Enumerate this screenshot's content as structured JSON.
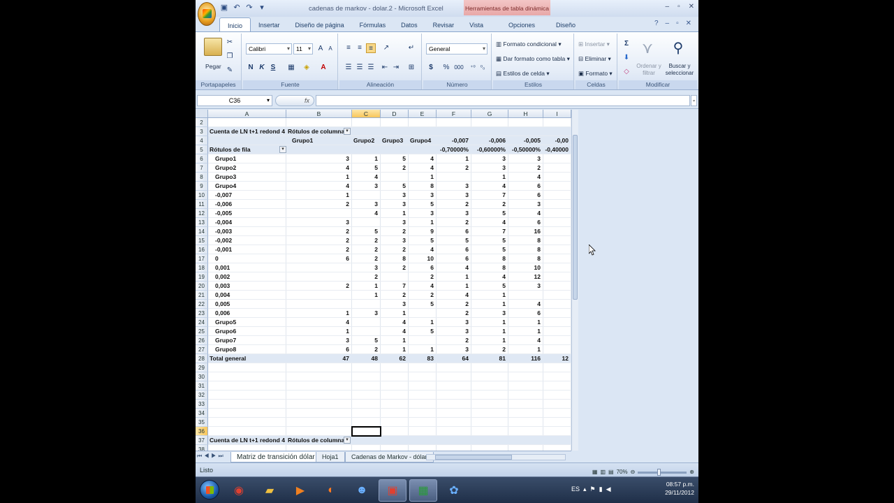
{
  "window": {
    "title": "cadenas de markov - dolar.2 - Microsoft Excel",
    "context_tab": "Herramientas de tabla dinámica"
  },
  "ribbon_tabs": [
    "Inicio",
    "Insertar",
    "Diseño de página",
    "Fórmulas",
    "Datos",
    "Revisar",
    "Vista",
    "Opciones",
    "Diseño"
  ],
  "ribbon": {
    "clipboard": {
      "paste": "Pegar",
      "label": "Portapapeles"
    },
    "font": {
      "name": "Calibri",
      "size": "11",
      "bold": "N",
      "italic": "K",
      "underline": "S",
      "label": "Fuente"
    },
    "align": {
      "label": "Alineación"
    },
    "number": {
      "format": "General",
      "currency": "$",
      "percent": "%",
      "thousands": "000",
      "label": "Número"
    },
    "styles": {
      "cond": "Formato condicional",
      "table": "Dar formato como tabla",
      "cell": "Estilos de celda",
      "label": "Estilos"
    },
    "cells": {
      "insert": "Insertar",
      "delete": "Eliminar",
      "format": "Formato",
      "label": "Celdas"
    },
    "edit": {
      "sort": "Ordenar y filtrar",
      "find": "Buscar y seleccionar",
      "label": "Modificar"
    }
  },
  "formula": {
    "namebox": "C36",
    "fx": "fx",
    "value": ""
  },
  "columns": [
    "A",
    "B",
    "C",
    "D",
    "E",
    "F",
    "G",
    "H",
    "I"
  ],
  "pivot": {
    "r3a": "Cuenta de LN t+1 redond 4",
    "r3b": "Rótulos de columna",
    "r4": [
      "Grupo1",
      "Grupo2",
      "Grupo3",
      "Grupo4",
      "-0,007",
      "-0,006",
      "-0,005",
      "-0,00"
    ],
    "r5a": "Rótulos de fila",
    "r5": [
      "-0,70000%",
      "-0,60000%",
      "-0,50000%",
      "-0,40000"
    ],
    "rows": [
      {
        "n": "6",
        "label": "Grupo1",
        "v": [
          "3",
          "1",
          "5",
          "4",
          "1",
          "3",
          "3"
        ]
      },
      {
        "n": "7",
        "label": "Grupo2",
        "v": [
          "4",
          "5",
          "2",
          "4",
          "2",
          "3",
          "2"
        ]
      },
      {
        "n": "8",
        "label": "Grupo3",
        "v": [
          "1",
          "4",
          "",
          "1",
          "",
          "1",
          "4"
        ]
      },
      {
        "n": "9",
        "label": "Grupo4",
        "v": [
          "4",
          "3",
          "5",
          "8",
          "3",
          "4",
          "6"
        ]
      },
      {
        "n": "10",
        "label": "-0,007",
        "v": [
          "1",
          "",
          "3",
          "3",
          "3",
          "7",
          "6"
        ]
      },
      {
        "n": "11",
        "label": "-0,006",
        "v": [
          "2",
          "3",
          "3",
          "5",
          "2",
          "2",
          "3"
        ]
      },
      {
        "n": "12",
        "label": "-0,005",
        "v": [
          "",
          "4",
          "1",
          "3",
          "3",
          "5",
          "4"
        ]
      },
      {
        "n": "13",
        "label": "-0,004",
        "v": [
          "3",
          "",
          "3",
          "1",
          "2",
          "4",
          "6"
        ]
      },
      {
        "n": "14",
        "label": "-0,003",
        "v": [
          "2",
          "5",
          "2",
          "9",
          "6",
          "7",
          "16"
        ]
      },
      {
        "n": "15",
        "label": "-0,002",
        "v": [
          "2",
          "2",
          "3",
          "5",
          "5",
          "5",
          "8"
        ]
      },
      {
        "n": "16",
        "label": "-0,001",
        "v": [
          "2",
          "2",
          "2",
          "4",
          "6",
          "5",
          "8"
        ]
      },
      {
        "n": "17",
        "label": "0",
        "v": [
          "6",
          "2",
          "8",
          "10",
          "6",
          "8",
          "8"
        ]
      },
      {
        "n": "18",
        "label": "0,001",
        "v": [
          "",
          "3",
          "2",
          "6",
          "4",
          "8",
          "10"
        ]
      },
      {
        "n": "19",
        "label": "0,002",
        "v": [
          "",
          "2",
          "",
          "2",
          "1",
          "4",
          "12"
        ]
      },
      {
        "n": "20",
        "label": "0,003",
        "v": [
          "2",
          "1",
          "7",
          "4",
          "1",
          "5",
          "3"
        ]
      },
      {
        "n": "21",
        "label": "0,004",
        "v": [
          "",
          "1",
          "2",
          "2",
          "4",
          "1",
          ""
        ]
      },
      {
        "n": "22",
        "label": "0,005",
        "v": [
          "",
          "",
          "3",
          "5",
          "2",
          "1",
          "4"
        ]
      },
      {
        "n": "23",
        "label": "0,006",
        "v": [
          "1",
          "3",
          "1",
          "",
          "2",
          "3",
          "6"
        ]
      },
      {
        "n": "24",
        "label": "Grupo5",
        "v": [
          "4",
          "",
          "4",
          "1",
          "3",
          "1",
          "1"
        ]
      },
      {
        "n": "25",
        "label": "Grupo6",
        "v": [
          "1",
          "",
          "4",
          "5",
          "3",
          "1",
          "1"
        ]
      },
      {
        "n": "26",
        "label": "Grupo7",
        "v": [
          "3",
          "5",
          "1",
          "",
          "2",
          "1",
          "4"
        ]
      },
      {
        "n": "27",
        "label": "Grupo8",
        "v": [
          "6",
          "2",
          "1",
          "1",
          "3",
          "2",
          "1"
        ]
      }
    ],
    "total": {
      "n": "28",
      "label": "Total general",
      "v": [
        "47",
        "48",
        "62",
        "83",
        "64",
        "81",
        "116",
        "12"
      ]
    },
    "empty_rows": [
      "29",
      "30",
      "31",
      "32",
      "33",
      "34",
      "35",
      "36"
    ],
    "r37a": "Cuenta de LN t+1 redond 4",
    "r37b": "Rótulos de columna"
  },
  "sheets": [
    "Matriz de transición dólar",
    "Hoja1",
    "Cadenas de Markov - dólar"
  ],
  "status": {
    "text": "Listo",
    "zoom": "70%"
  },
  "tray": {
    "lang": "ES",
    "time": "08:57 p.m.",
    "date": "29/11/2012"
  }
}
